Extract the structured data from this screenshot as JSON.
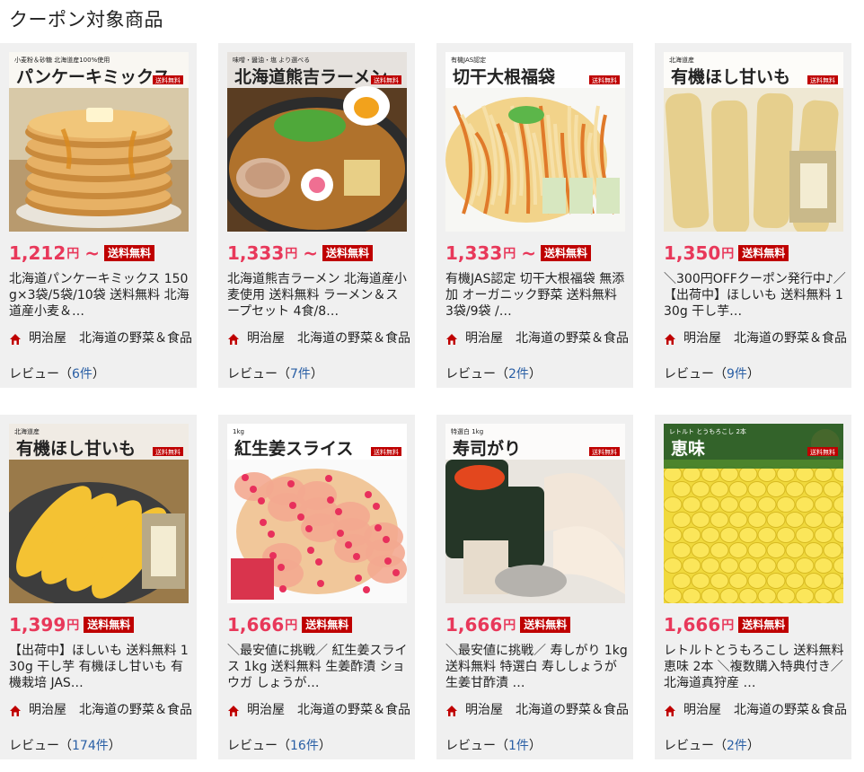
{
  "page": {
    "title": "クーポン対象商品"
  },
  "labels": {
    "shipping": "送料無料",
    "review_prefix": "レビュー（",
    "review_suffix": "件",
    "review_close": "）",
    "yen": "円",
    "tilde": "~"
  },
  "colors": {
    "price": "#e8385a",
    "badge": "#bf0000",
    "card_bg": "#f0f0f0",
    "link": "#2a5fa5"
  },
  "products": [
    {
      "image": "pancake-mix",
      "image_caption": "パンケーキミックス",
      "image_sub": "小麦粉＆砂糖 北海道産100%使用",
      "price": "1,212",
      "from": true,
      "title": "北海道パンケーキミックス 150g×3袋/5袋/10袋 送料無料 北海道産小麦＆…",
      "shop": "明治屋　北海道の野菜＆食品",
      "reviews": "6"
    },
    {
      "image": "ramen",
      "image_caption": "北海道熊吉ラーメン",
      "image_sub": "味噌・醤油・塩 より選べる",
      "price": "1,333",
      "from": true,
      "title": "北海道熊吉ラーメン 北海道産小麦使用 送料無料 ラーメン＆スープセット 4食/8…",
      "shop": "明治屋　北海道の野菜＆食品",
      "reviews": "7"
    },
    {
      "image": "kiriboshi",
      "image_caption": "切干大根福袋",
      "image_sub": "有機JAS認定",
      "price": "1,333",
      "from": true,
      "title": "有機JAS認定 切干大根福袋 無添加 オーガニック野菜 送料無料 3袋/9袋 /…",
      "shop": "明治屋　北海道の野菜＆食品",
      "reviews": "2"
    },
    {
      "image": "hoshiimo-1",
      "image_caption": "有機ほし甘いも",
      "image_sub": "北海道産",
      "price": "1,350",
      "from": false,
      "title": "＼300円OFFクーポン発行中♪／【出荷中】ほしいも 送料無料 130g 干し芋…",
      "shop": "明治屋　北海道の野菜＆食品",
      "reviews": "9"
    },
    {
      "image": "hoshiimo-2",
      "image_caption": "有機ほし甘いも",
      "image_sub": "北海道産",
      "price": "1,399",
      "from": false,
      "title": "【出荷中】ほしいも 送料無料 130g 干し芋 有機ほし甘いも 有機栽培 JAS…",
      "shop": "明治屋　北海道の野菜＆食品",
      "reviews": "174"
    },
    {
      "image": "beni-shoga",
      "image_caption": "紅生姜スライス",
      "image_sub": "1kg",
      "price": "1,666",
      "from": false,
      "title": "＼最安値に挑戦／ 紅生姜スライス 1kg 送料無料 生姜酢漬 ショウガ しょうが…",
      "shop": "明治屋　北海道の野菜＆食品",
      "reviews": "16"
    },
    {
      "image": "sushi-gari",
      "image_caption": "寿司がり",
      "image_sub": "特選白 1kg",
      "price": "1,666",
      "from": false,
      "title": "＼最安値に挑戦／ 寿しがり 1kg 送料無料 特選白 寿ししょうが 生姜甘酢漬 …",
      "shop": "明治屋　北海道の野菜＆食品",
      "reviews": "1"
    },
    {
      "image": "corn",
      "image_caption": "恵味",
      "image_sub": "レトルト とうもろこし 2本",
      "price": "1,666",
      "from": false,
      "title": "レトルトとうもろこし 送料無料 恵味 2本 ＼複数購入特典付き／ 北海道真狩産 …",
      "shop": "明治屋　北海道の野菜＆食品",
      "reviews": "2"
    }
  ]
}
